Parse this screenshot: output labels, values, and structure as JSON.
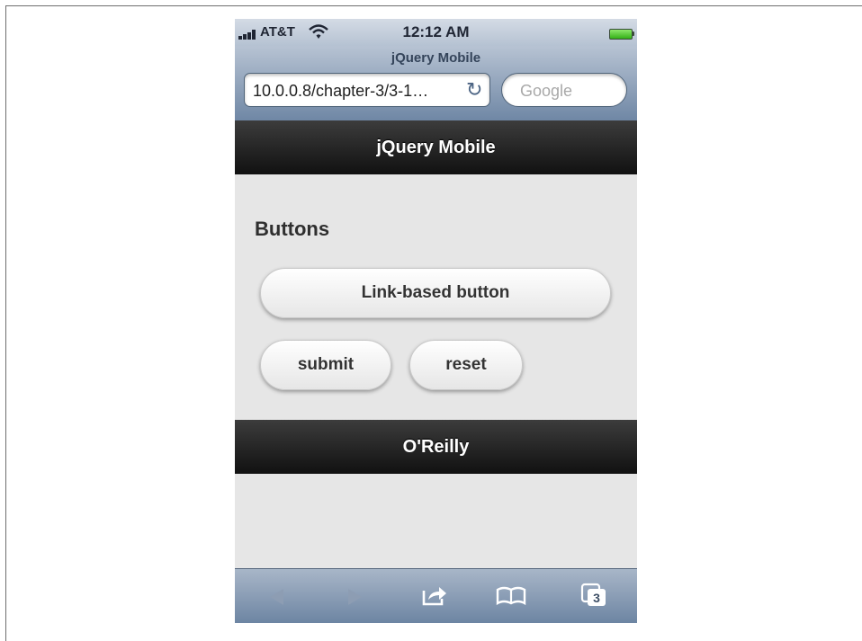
{
  "status_bar": {
    "carrier": "AT&T",
    "time": "12:12 AM",
    "icons": [
      "signal-icon",
      "wifi-icon",
      "battery-icon"
    ]
  },
  "browser": {
    "page_title": "jQuery Mobile",
    "url": "10.0.0.8/chapter-3/3-1…",
    "search_placeholder": "Google",
    "tab_count": "3",
    "toolbar_icons": [
      "back-icon",
      "forward-icon",
      "share-icon",
      "bookmarks-icon",
      "tabs-icon"
    ]
  },
  "page": {
    "header_title": "jQuery Mobile",
    "heading": "Buttons",
    "buttons": {
      "link": "Link-based button",
      "submit": "submit",
      "reset": "reset"
    },
    "footer_title": "O'Reilly"
  },
  "colors": {
    "bar_dark": "#1a1a1a",
    "content_bg": "#e6e6e6",
    "safari_blue": "#6f87a5"
  }
}
